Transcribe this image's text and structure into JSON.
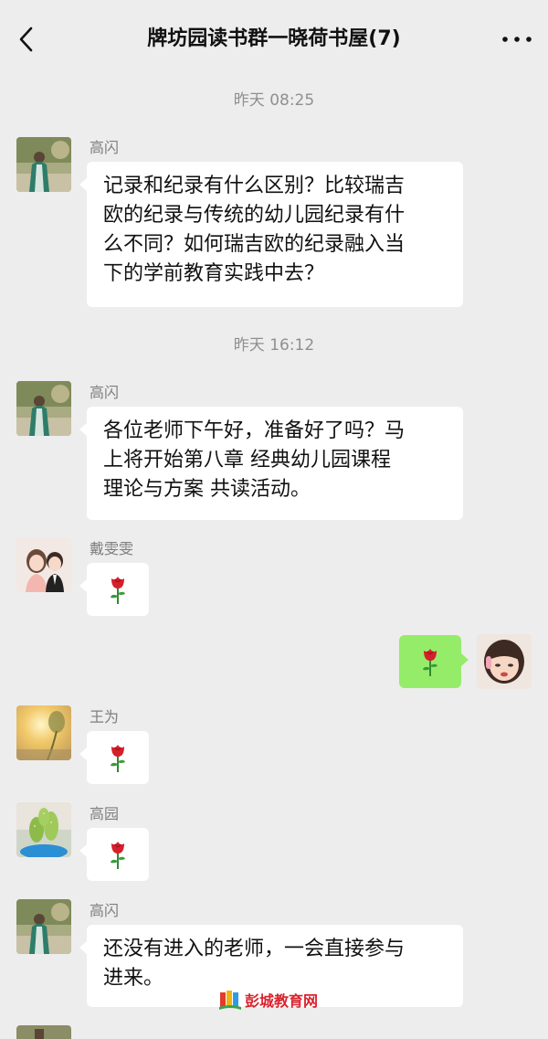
{
  "header": {
    "title": "牌坊园读书群一晓荷书屋(7)",
    "back_icon": "chevron-left-icon",
    "more_icon": "more-dots-icon"
  },
  "timestamps": [
    "昨天 08:25",
    "昨天 16:12"
  ],
  "messages": [
    {
      "sender": "高闪",
      "text": "记录和纪录有什么区别？比较瑞吉欧的纪录与传统的幼儿园纪录有什么不同？如何瑞吉欧的纪录融入当下的学前教育实践中去？",
      "lines": [
        "记录和纪录有什么区别？比较瑞吉",
        "欧的纪录与传统的幼儿园纪录有什",
        "么不同？如何瑞吉欧的纪录融入当",
        "下的学前教育实践中去？"
      ]
    },
    {
      "sender": "高闪",
      "text": "各位老师下午好，准备好了吗？马上将开始第八章 经典幼儿园课程理论与方案 共读活动。",
      "lines": [
        "各位老师下午好，准备好了吗？马",
        "上将开始第八章 经典幼儿园课程",
        "理论与方案 共读活动。"
      ]
    },
    {
      "sender": "戴雯雯",
      "emoji": "rose-icon"
    },
    {
      "sender": "",
      "emoji": "rose-icon",
      "self": true
    },
    {
      "sender": "王为",
      "emoji": "rose-icon"
    },
    {
      "sender": "高园",
      "emoji": "rose-icon"
    },
    {
      "sender": "高闪",
      "text": "还没有进入的老师，一会直接参与进来。",
      "lines": [
        "还没有进入的老师，一会直接参与",
        "进来。"
      ]
    }
  ],
  "watermark": {
    "text": "彭城教育网"
  },
  "colors": {
    "background": "#ededed",
    "bubble_other": "#ffffff",
    "bubble_self": "#95ec69",
    "watermark_red": "#d9232d"
  }
}
